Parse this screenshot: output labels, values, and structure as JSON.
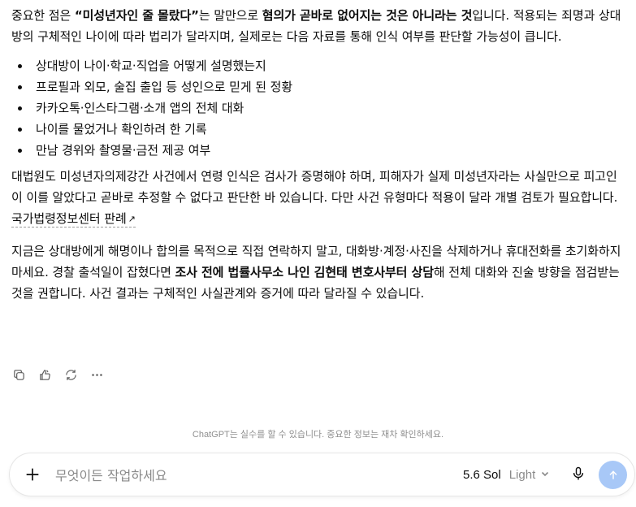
{
  "message": {
    "p1": {
      "pre": "중요한 점은 ",
      "bold1": "“미성년자인 줄 몰랐다”",
      "mid": "는 말만으로 ",
      "bold2": "혐의가 곧바로 없어지는 것은 아니라는 것",
      "post": "입니다. 적용되는 죄명과 상대방의 구체적인 나이에 따라 법리가 달라지며, 실제로는 다음 자료를 통해 인식 여부를 판단할 가능성이 큽니다."
    },
    "list": [
      "상대방이 나이·학교·직업을 어떻게 설명했는지",
      "프로필과 외모, 술집 출입 등 성인으로 믿게 된 정황",
      "카카오톡·인스타그램·소개 앱의 전체 대화",
      "나이를 물었거나 확인하려 한 기록",
      "만남 경위와 촬영물·금전 제공 여부"
    ],
    "p2": {
      "text": "대법원도 미성년자의제강간 사건에서 연령 인식은 검사가 증명해야 하며, 피해자가 실제 미성년자라는 사실만으로 피고인이 이를 알았다고 곧바로 추정할 수 없다고 판단한 바 있습니다. 다만 사건 유형마다 적용이 달라 개별 검토가 필요합니다.",
      "source_label": "국가법령정보센터 판례",
      "source_icon": "external-arrow-icon"
    },
    "p3": {
      "pre": "지금은 상대방에게 해명이나 합의를 목적으로 직접 연락하지 말고, 대화방·계정·사진을 삭제하거나 휴대전화를 초기화하지 마세요. 경찰 출석일이 잡혔다면 ",
      "bold": "조사 전에 법률사무소 나인 김현태 변호사부터 상담",
      "post": "해 전체 대화와 진술 방향을 점검받는 것을 권합니다. 사건 결과는 구체적인 사실관계와 증거에 따라 달라질 수 있습니다."
    }
  },
  "actions": {
    "copy_icon": "copy-icon",
    "thumbs_icon": "thumbs-icon",
    "regenerate_icon": "regenerate-icon",
    "more_icon": "more-icon"
  },
  "footer": {
    "note": "ChatGPT는 실수를 할 수 있습니다. 중요한 정보는 재차 확인하세요."
  },
  "composer": {
    "placeholder": "무엇이든 작업하세요",
    "model_name": "5.6 Sol",
    "model_variant": "Light",
    "send_color": "#a8c8f7"
  }
}
